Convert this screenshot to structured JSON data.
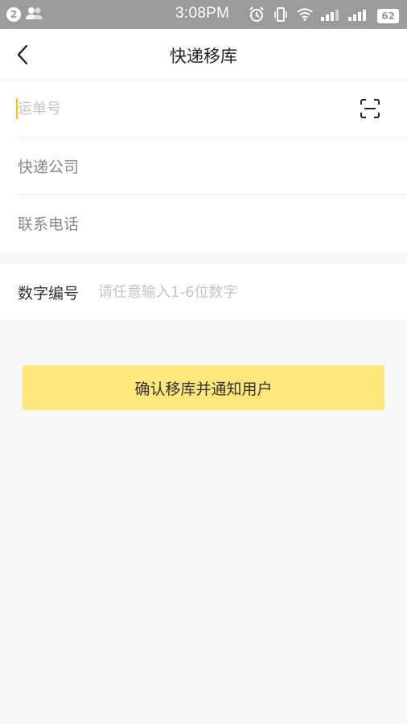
{
  "status_bar": {
    "notification_count": "2",
    "time": "3:08PM",
    "battery": "62"
  },
  "navbar": {
    "back_icon": "chevron-left-icon",
    "title": "快递移库"
  },
  "form": {
    "tracking_number": {
      "placeholder": "运单号",
      "value": ""
    },
    "courier_company": {
      "label": "快递公司"
    },
    "phone": {
      "label": "联系电话"
    },
    "scan_icon": "scan-icon"
  },
  "digit_code": {
    "label": "数字编号",
    "placeholder": "请任意输入1-6位数字",
    "value": ""
  },
  "confirm_button": {
    "label": "确认移库并通知用户",
    "color": "#ffe77c"
  },
  "colors": {
    "accent": "#f5c400",
    "status_bar": "#9b9b9b"
  }
}
